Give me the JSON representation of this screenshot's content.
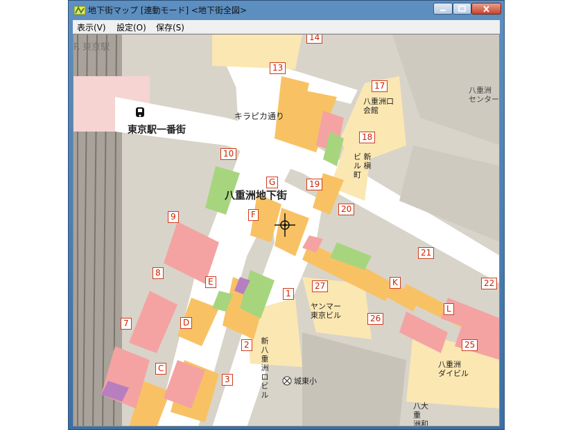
{
  "window": {
    "title": "地下街マップ [連動モード] <地下街全図>"
  },
  "menu": {
    "items": [
      "表示(V)",
      "設定(O)",
      "保存(S)"
    ]
  },
  "map": {
    "labels": {
      "station_top": "R 東京駅",
      "tokyo_ichibangai": "東京駅一番街",
      "kirapika": "キラピカ通り",
      "yaesu_chikagai": "八重洲地下街",
      "yaesu_gate_hall": "八重洲口\n会館",
      "yaesu_center": "八重洲\nセンター",
      "biru_kaji": "ビ 新\nル 槇\n町",
      "yanmar": "ヤンマー\n東京ビル",
      "yaesu_dai": "八重洲\nダイビル",
      "shin_yaesu": "新\n八\n重\n洲\nロ\nビ\nル",
      "school": "城東小",
      "hachi_dai": "八大\n重\n洲和"
    },
    "numbers": [
      "14",
      "13",
      "17",
      "18",
      "10",
      "G",
      "19",
      "9",
      "F",
      "20",
      "8",
      "21",
      "E",
      "27",
      "K",
      "22",
      "7",
      "1",
      "D",
      "26",
      "L",
      "2",
      "25",
      "C",
      "3"
    ]
  }
}
